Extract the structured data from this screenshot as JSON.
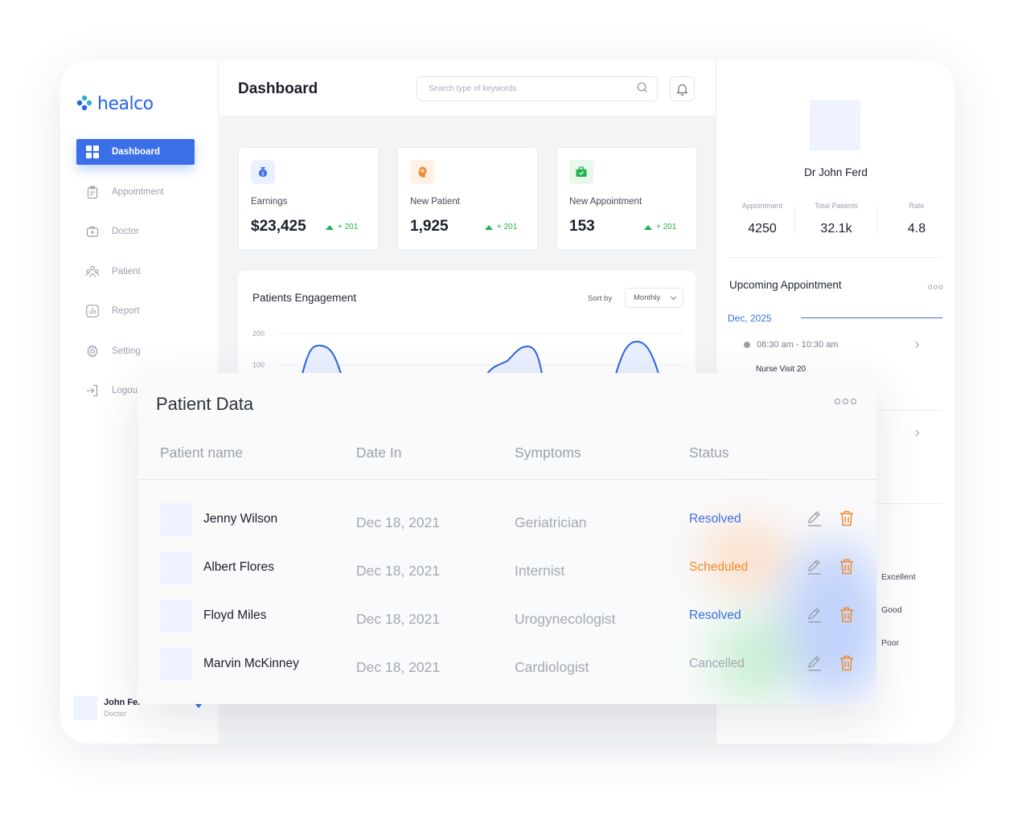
{
  "sidebar": {
    "logo": "healco",
    "items": [
      {
        "label": "Dashboard"
      },
      {
        "label": "Appointment"
      },
      {
        "label": "Doctor"
      },
      {
        "label": "Patient"
      },
      {
        "label": "Report"
      },
      {
        "label": "Setting"
      },
      {
        "label": "Logou"
      }
    ],
    "user": {
      "name": "John Fe.",
      "role": "Doctor"
    }
  },
  "header": {
    "title": "Dashboard",
    "search_placeholder": "Search type of keywords"
  },
  "cards": [
    {
      "label": "Earnings",
      "value": "$23,425",
      "delta": "+ 201",
      "icon": "money-bag-icon",
      "icon_color": "#3b6fe8",
      "icon_bg": "#eaf0ff"
    },
    {
      "label": "New Patient",
      "value": "1,925",
      "delta": "+ 201",
      "icon": "head-gear-icon",
      "icon_color": "#f08a2c",
      "icon_bg": "#fff1e6"
    },
    {
      "label": "New Appointment",
      "value": "153",
      "delta": "+ 201",
      "icon": "briefcase-icon",
      "icon_color": "#21b24a",
      "icon_bg": "#e8f8ec"
    }
  ],
  "engagement": {
    "title": "Patients Engagement",
    "sort_label": "Sort by",
    "sort_value": "Monthly",
    "y_ticks": [
      "200",
      "100"
    ]
  },
  "doctor": {
    "name": "Dr John Ferd",
    "stats": [
      {
        "label": "Appointment",
        "value": "4250"
      },
      {
        "label": "Total Patients",
        "value": "32.1k"
      },
      {
        "label": "Rate",
        "value": "4.8"
      }
    ]
  },
  "upcoming": {
    "title": "Upcoming Appointment",
    "month": "Dec, 2025",
    "time": "08:30 am - 10:30 am",
    "subtitle": "Nurse Visit 20"
  },
  "ratings": [
    "Excellent",
    "Good",
    "Poor"
  ],
  "patient_data": {
    "title": "Patient Data",
    "columns": [
      "Patient name",
      "Date In",
      "Symptoms",
      "Status"
    ],
    "rows": [
      {
        "name": "Jenny Wilson",
        "date": "Dec 18, 2021",
        "symptom": "Geriatrician",
        "status": "Resolved",
        "status_color": "#3b6fe8"
      },
      {
        "name": "Albert Flores",
        "date": "Dec 18, 2021",
        "symptom": "Internist",
        "status": "Scheduled",
        "status_color": "#f08a2c"
      },
      {
        "name": "Floyd Miles",
        "date": "Dec 18, 2021",
        "symptom": "Urogynecologist",
        "status": "Resolved",
        "status_color": "#3b6fe8"
      },
      {
        "name": "Marvin McKinney",
        "date": "Dec 18, 2021",
        "symptom": "Cardiologist",
        "status": "Cancelled",
        "status_color": "#a3a8b2"
      }
    ]
  },
  "colors": {
    "accent": "#3b6fe8",
    "positive": "#21b24a",
    "warning": "#f08a2c"
  }
}
